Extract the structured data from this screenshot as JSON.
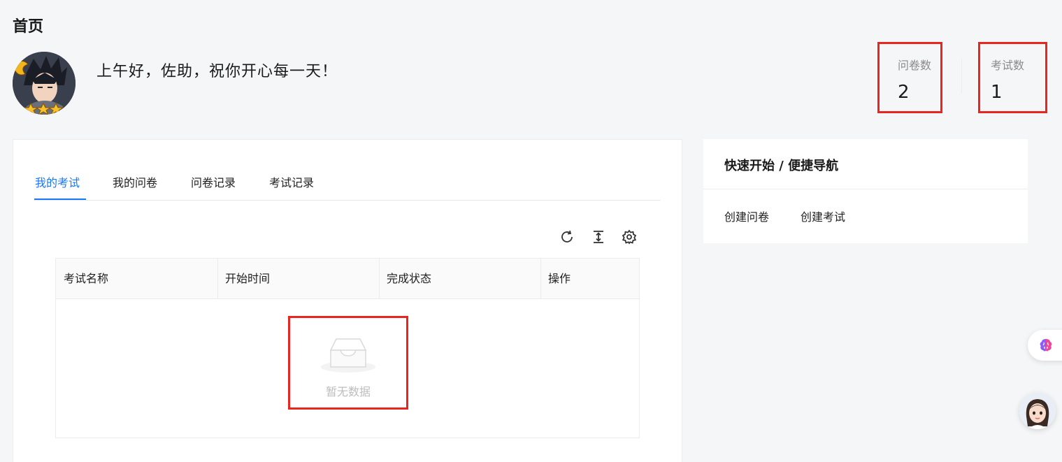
{
  "page": {
    "title": "首页"
  },
  "header": {
    "greeting": "上午好，佐助，祝你开心每一天！",
    "stats": [
      {
        "label": "问卷数",
        "value": "2"
      },
      {
        "label": "考试数",
        "value": "1"
      }
    ]
  },
  "tabs": [
    {
      "label": "我的考试",
      "active": true
    },
    {
      "label": "我的问卷",
      "active": false
    },
    {
      "label": "问卷记录",
      "active": false
    },
    {
      "label": "考试记录",
      "active": false
    }
  ],
  "toolbar": {
    "icons": [
      "refresh-icon",
      "column-height-icon",
      "settings-icon"
    ]
  },
  "table": {
    "columns": [
      "考试名称",
      "开始时间",
      "完成状态",
      "操作"
    ],
    "rows": [],
    "empty_text": "暂无数据"
  },
  "quick_nav": {
    "title": "快速开始 / 便捷导航",
    "links": [
      "创建问卷",
      "创建考试"
    ]
  },
  "colors": {
    "accent": "#1677ff",
    "highlight_border": "#e8261f",
    "background": "#f5f6f8"
  }
}
